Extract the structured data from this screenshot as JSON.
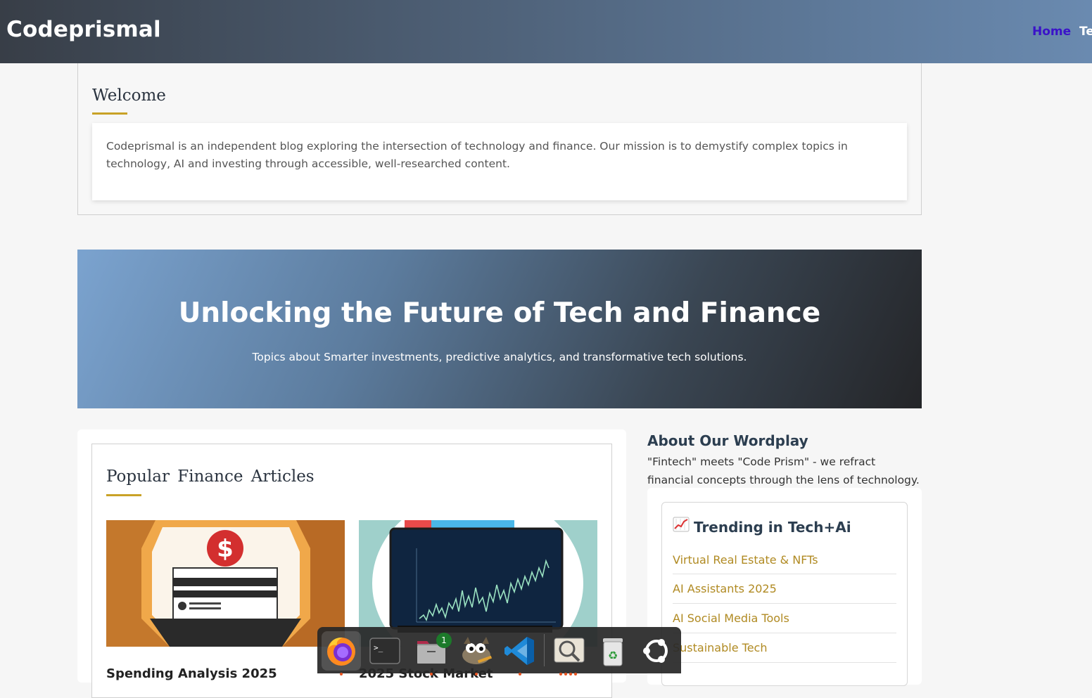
{
  "header": {
    "brand": "Codeprismal",
    "nav": [
      "Home",
      "Te"
    ]
  },
  "welcome": {
    "title": "Welcome",
    "text": "Codeprismal is an independent blog exploring the intersection of technology and finance. Our mission is to demystify complex topics in technology, AI and investing through accessible, well-researched content."
  },
  "hero": {
    "title": "Unlocking the Future of Tech and Finance",
    "subtitle": "Topics about Smarter investments, predictive analytics, and transformative tech solutions."
  },
  "articles": {
    "title": "Popular Finance Articles",
    "items": [
      {
        "title": "Spending Analysis 2025"
      },
      {
        "title": "2025 Stock Market"
      }
    ]
  },
  "about": {
    "title": "About Our Wordplay",
    "text": "\"Fintech\" meets \"Code Prism\" - we refract financial concepts through the lens of technology."
  },
  "trending": {
    "icon": "chart-increasing-icon",
    "title": "Trending in Tech+Ai",
    "items": [
      "Virtual Real Estate & NFTs",
      "AI Assistants 2025",
      "AI Social Media Tools",
      "Sustainable Tech"
    ]
  },
  "dock": {
    "items": [
      "firefox",
      "terminal",
      "files",
      "gimp",
      "vscode",
      "image-viewer",
      "trash",
      "ubuntu-menu"
    ],
    "files_badge": "1"
  },
  "colors": {
    "accent_gold": "#c9a227",
    "link_gold": "#b08a22",
    "nav_active": "#3a12c9"
  }
}
